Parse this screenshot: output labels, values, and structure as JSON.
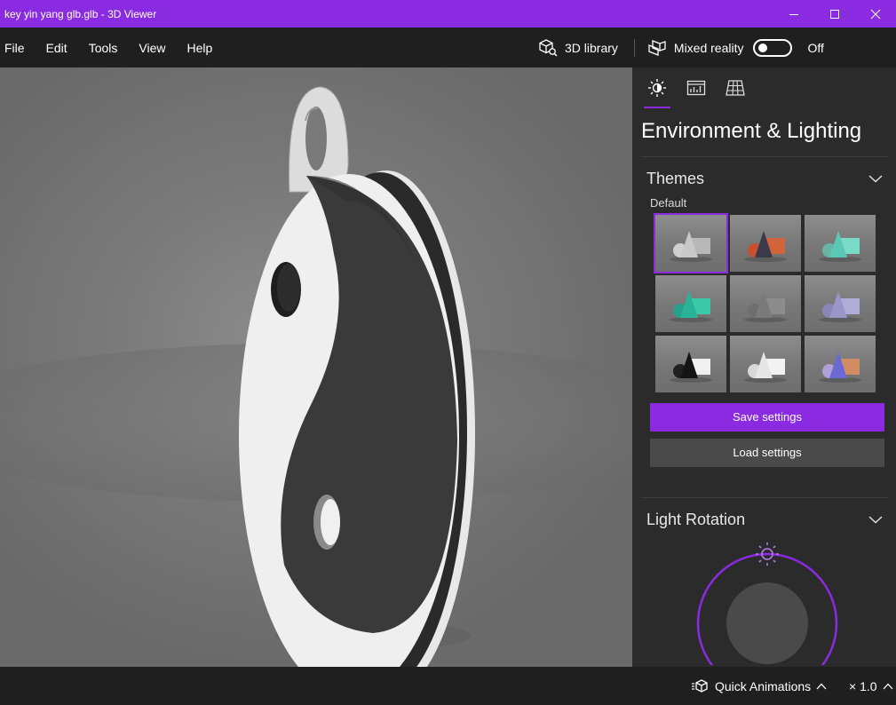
{
  "window": {
    "title": "key yin yang glb.glb - 3D Viewer"
  },
  "menu": {
    "items": [
      "File",
      "Edit",
      "Tools",
      "View",
      "Help"
    ]
  },
  "toolbar": {
    "library_label": "3D library",
    "mixed_reality_label": "Mixed reality",
    "mixed_reality_state": "Off"
  },
  "panel": {
    "tabs": [
      "environment-tab",
      "stats-tab",
      "grid-tab"
    ],
    "heading": "Environment & Lighting",
    "themes": {
      "title": "Themes",
      "subtitle": "Default",
      "selected_index": 0,
      "items": [
        {
          "name": "theme-light",
          "colors": [
            "#c8c8c8",
            "#b8b8b8",
            "#d0d0d0"
          ]
        },
        {
          "name": "theme-dark-orange",
          "colors": [
            "#3a3a4a",
            "#d2643c",
            "#c8502e"
          ]
        },
        {
          "name": "theme-teal",
          "colors": [
            "#5ac8b4",
            "#7adcc8",
            "#6ab4a4"
          ]
        },
        {
          "name": "theme-green-cyan",
          "colors": [
            "#28b496",
            "#3cc8aa",
            "#2aa08c"
          ]
        },
        {
          "name": "theme-grey",
          "colors": [
            "#7a7a7a",
            "#8c8c8c",
            "#6e6e6e"
          ]
        },
        {
          "name": "theme-lilac",
          "colors": [
            "#9a96c8",
            "#b0acd8",
            "#8a86b8"
          ]
        },
        {
          "name": "theme-black-white",
          "colors": [
            "#141414",
            "#f0f0f0",
            "#202020"
          ]
        },
        {
          "name": "theme-white",
          "colors": [
            "#e6e6e6",
            "#f2f2f2",
            "#d8d8d8"
          ]
        },
        {
          "name": "theme-pastel",
          "colors": [
            "#6a6ad2",
            "#d28c64",
            "#b0a0d8"
          ]
        }
      ]
    },
    "save_label": "Save settings",
    "load_label": "Load settings",
    "light_rotation": {
      "title": "Light Rotation"
    }
  },
  "bottom": {
    "quick_animations_label": "Quick Animations",
    "speed_label": "× 1.0"
  },
  "colors": {
    "accent": "#8a2be2",
    "panel_bg": "#2b2b2b",
    "chrome_bg": "#1f1f1f"
  }
}
